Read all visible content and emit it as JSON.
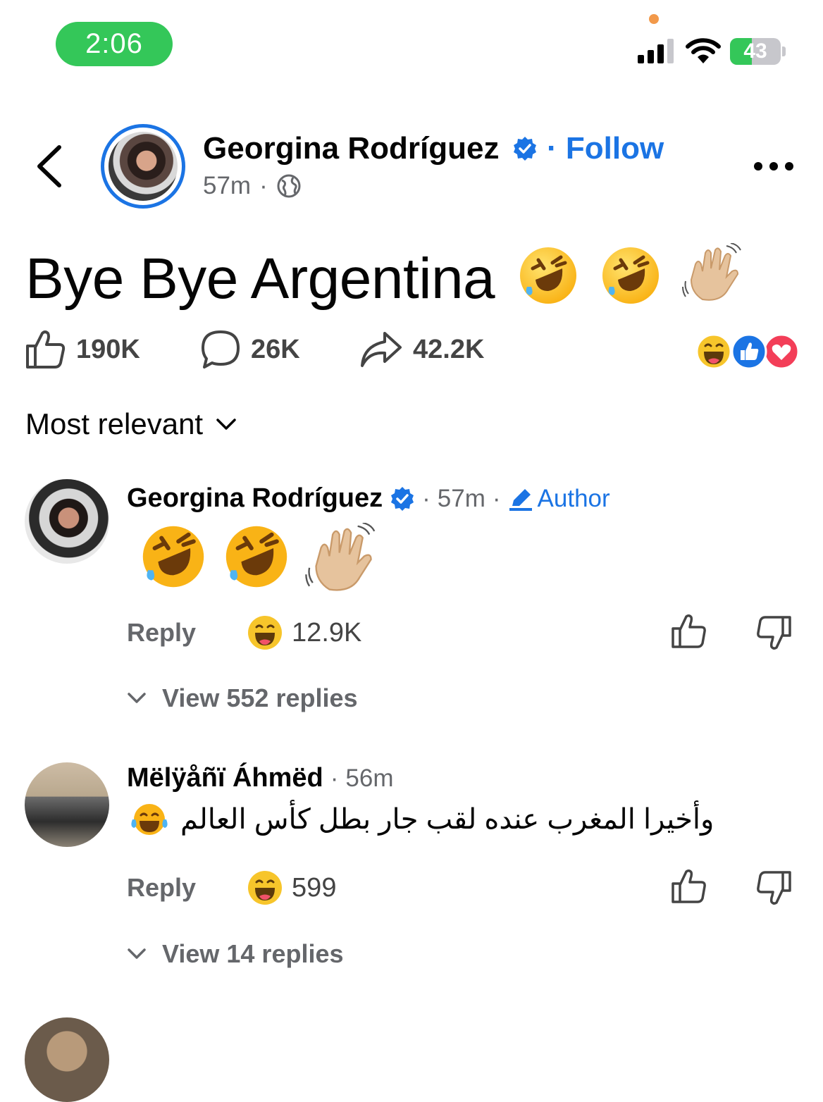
{
  "status_bar": {
    "time": "2:06",
    "battery": "43",
    "battery_level": 0.43
  },
  "header": {
    "poster_name": "Georgina Rodríguez",
    "follow_label": "Follow",
    "time": "57m"
  },
  "post": {
    "text": "Bye Bye Argentina",
    "emojis": [
      "🤣",
      "🤣",
      "👋🏼"
    ],
    "likes": "190K",
    "comments": "26K",
    "shares": "42.2K",
    "reaction_icons": [
      "haha",
      "like",
      "love"
    ]
  },
  "sort": {
    "label": "Most relevant"
  },
  "comments": [
    {
      "name": "Georgina Rodríguez",
      "time": "57m",
      "badge": "Author",
      "body_emojis": [
        "🤣",
        "🤣",
        "👋🏼"
      ],
      "reply_label": "Reply",
      "reaction_count": "12.9K",
      "view_replies": "View 552 replies"
    },
    {
      "name": "Mëlÿåñï Áhmëd",
      "time": "56m",
      "text": "وأخيرا المغرب عنده لقب جار بطل كأس العالم",
      "text_emoji": "😂",
      "reply_label": "Reply",
      "reaction_count": "599",
      "view_replies": "View 14 replies"
    }
  ]
}
